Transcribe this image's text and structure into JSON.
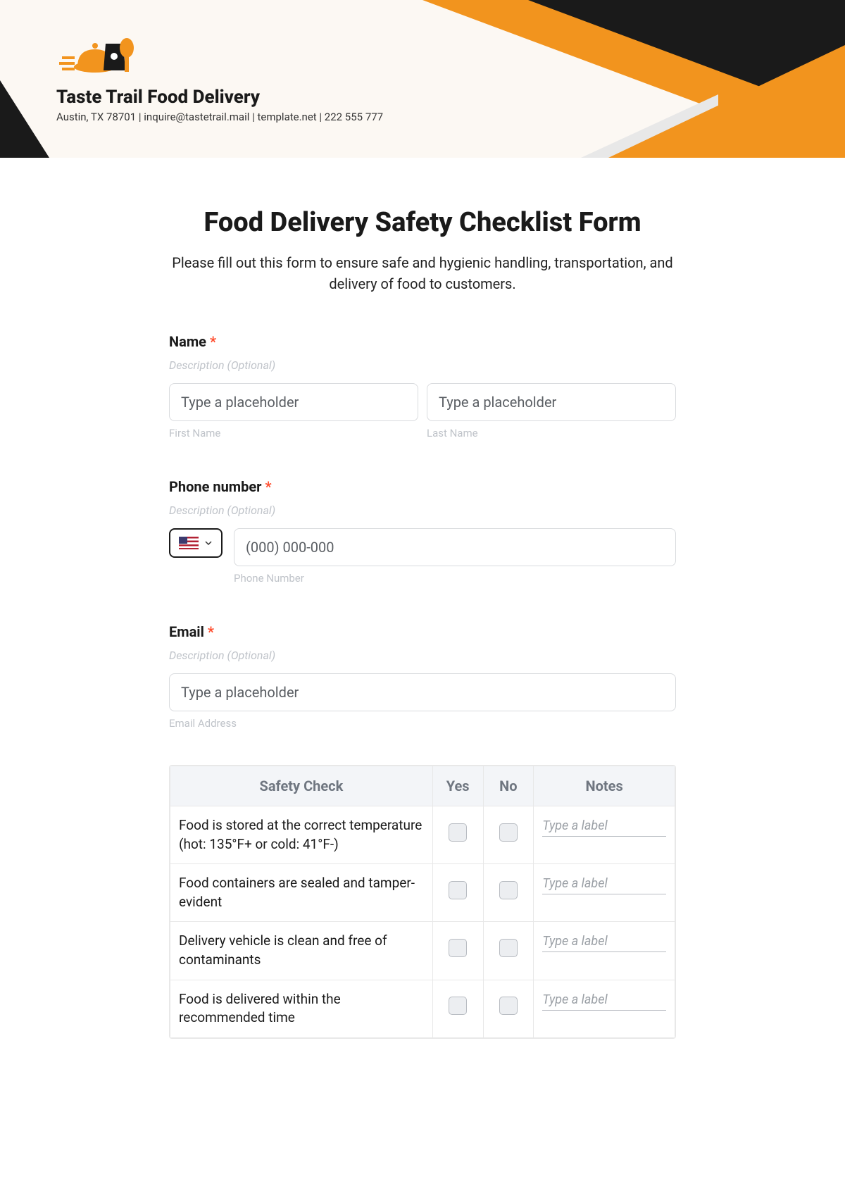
{
  "header": {
    "brand_name": "Taste Trail Food Delivery",
    "brand_sub": "Austin, TX 78701 | inquire@tastetrail.mail | template.net | 222 555 777"
  },
  "form": {
    "title": "Food Delivery Safety Checklist Form",
    "intro": "Please fill out this form to ensure safe and hygienic handling, transportation, and delivery of food to customers.",
    "name": {
      "label": "Name",
      "desc": "Description (Optional)",
      "first_placeholder": "Type a placeholder",
      "last_placeholder": "Type a placeholder",
      "first_sub": "First Name",
      "last_sub": "Last Name"
    },
    "phone": {
      "label": "Phone number",
      "desc": "Description (Optional)",
      "placeholder": "(000) 000-000",
      "sub": "Phone Number"
    },
    "email": {
      "label": "Email",
      "desc": "Description (Optional)",
      "placeholder": "Type a placeholder",
      "sub": "Email Address"
    },
    "table": {
      "headers": {
        "check": "Safety Check",
        "yes": "Yes",
        "no": "No",
        "notes": "Notes"
      },
      "note_placeholder": "Type a label",
      "rows": [
        {
          "text": "Food is stored at the correct temperature (hot: 135°F+ or cold: 41°F-)"
        },
        {
          "text": "Food containers are sealed and tamper-evident"
        },
        {
          "text": "Delivery vehicle is clean and free of contaminants"
        },
        {
          "text": "Food is delivered within the recommended time"
        }
      ]
    }
  },
  "required_mark": "*"
}
